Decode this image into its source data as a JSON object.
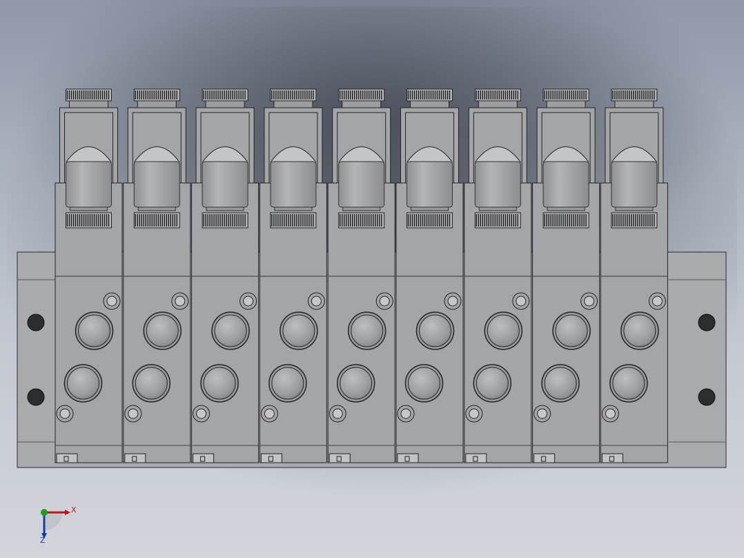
{
  "viewport": {
    "background_top": "#8e98a8",
    "background_bottom": "#d2d5db",
    "model_color": "#a4a5a8"
  },
  "model": {
    "description_name": "valve-manifold",
    "valve_count": 9
  },
  "triad": {
    "x_label": "X",
    "z_label": "Z",
    "x_color": "#c0141a",
    "y_color": "#1aa01a",
    "z_color": "#1a3aa8"
  }
}
